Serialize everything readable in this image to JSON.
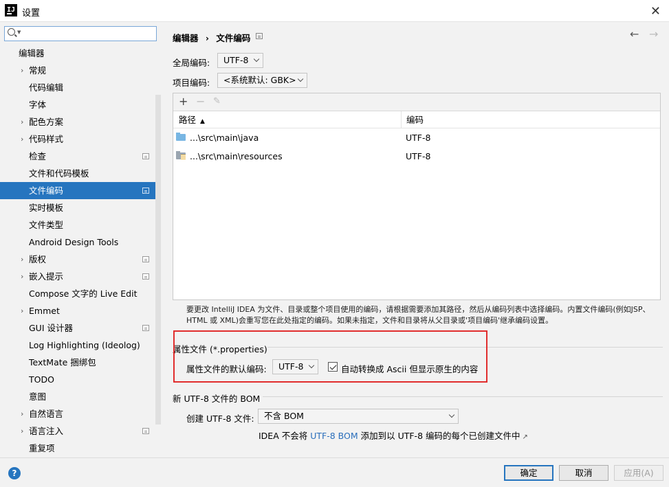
{
  "window": {
    "title": "设置",
    "logo_text": "IJ"
  },
  "search": {
    "placeholder": "",
    "value": ""
  },
  "sidebar": {
    "items": [
      {
        "label": "编辑器",
        "root": true
      },
      {
        "label": "常规",
        "arrow": true
      },
      {
        "label": "代码编辑"
      },
      {
        "label": "字体"
      },
      {
        "label": "配色方案",
        "arrow": true
      },
      {
        "label": "代码样式",
        "arrow": true
      },
      {
        "label": "检查",
        "badge": true
      },
      {
        "label": "文件和代码模板"
      },
      {
        "label": "文件编码",
        "badge": true,
        "selected": true
      },
      {
        "label": "实时模板"
      },
      {
        "label": "文件类型"
      },
      {
        "label": "Android Design Tools"
      },
      {
        "label": "版权",
        "arrow": true,
        "badge": true
      },
      {
        "label": "嵌入提示",
        "arrow": true,
        "badge": true
      },
      {
        "label": "Compose 文字的 Live Edit"
      },
      {
        "label": "Emmet",
        "arrow": true
      },
      {
        "label": "GUI 设计器",
        "badge": true
      },
      {
        "label": "Log Highlighting (Ideolog)"
      },
      {
        "label": "TextMate 捆绑包"
      },
      {
        "label": "TODO"
      },
      {
        "label": "意图"
      },
      {
        "label": "自然语言",
        "arrow": true
      },
      {
        "label": "语言注入",
        "arrow": true,
        "badge": true
      },
      {
        "label": "重复项"
      }
    ]
  },
  "breadcrumb": {
    "parent": "编辑器",
    "separator": "›",
    "current": "文件编码"
  },
  "nav": {
    "back": "←",
    "forward": "→"
  },
  "global_encoding": {
    "label": "全局编码:",
    "value": "UTF-8"
  },
  "project_encoding": {
    "label": "项目编码:",
    "value": "<系统默认: GBK>"
  },
  "table": {
    "toolbar": {
      "add": "+",
      "remove": "−",
      "edit": "✎"
    },
    "columns": {
      "path": "路径",
      "sort_indicator": "▲",
      "encoding": "编码"
    },
    "rows": [
      {
        "path": "...\\src\\main\\java",
        "encoding": "UTF-8",
        "icon": "source-folder-icon"
      },
      {
        "path": "...\\src\\main\\resources",
        "encoding": "UTF-8",
        "icon": "resources-folder-icon"
      }
    ]
  },
  "hint": "要更改 IntelliJ IDEA 为文件、目录或整个项目使用的编码，请根据需要添加其路径，然后从编码列表中选择编码。内置文件编码(例如JSP、HTML 或 XML)会重写您在此处指定的编码。如果未指定，文件和目录将从父目录或'项目编码'继承编码设置。",
  "properties": {
    "title": "属性文件 (*.properties)",
    "default_label": "属性文件的默认编码:",
    "default_value": "UTF-8",
    "ascii_checkbox_label": "自动转换成 Ascii 但显示原生的内容",
    "ascii_checked": true
  },
  "bom": {
    "title": "新 UTF-8 文件的 BOM",
    "create_label": "创建 UTF-8 文件:",
    "create_value": "不含 BOM",
    "note_prefix": "IDEA 不会将",
    "note_link": "UTF-8 BOM",
    "note_suffix": "添加到以 UTF-8 编码的每个已创建文件中",
    "note_ext": "↗"
  },
  "buttons": {
    "help": "?",
    "ok": "确定",
    "cancel": "取消",
    "apply": "应用(A)"
  },
  "colors": {
    "accent": "#2675bf",
    "highlight_box": "#e12d2d",
    "link": "#2a6ebb"
  }
}
